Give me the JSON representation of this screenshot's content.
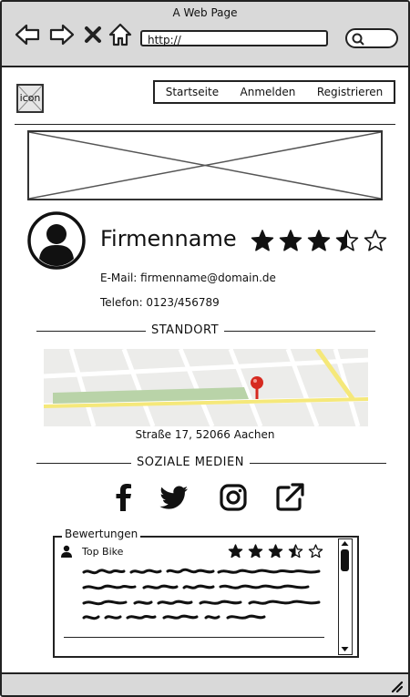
{
  "window": {
    "title": "A Web Page"
  },
  "addressbar": {
    "url": "http://"
  },
  "logo": {
    "label": "icon"
  },
  "nav": {
    "items": [
      "Startseite",
      "Anmelden",
      "Registrieren"
    ]
  },
  "company": {
    "name": "Firmenname",
    "rating": 3.5,
    "rating_max": 5,
    "email": "E-Mail: firmenname@domain.de",
    "phone": "Telefon: 0123/456789"
  },
  "location": {
    "heading": "STANDORT",
    "address": "Straße 17, 52066 Aachen"
  },
  "social": {
    "heading": "SOZIALE MEDIEN",
    "icons": [
      "facebook-icon",
      "twitter-icon",
      "instagram-icon",
      "external-link-icon"
    ]
  },
  "reviews": {
    "legend": "Bewertungen",
    "items": [
      {
        "author": "Top Bike",
        "rating": 3.5,
        "rating_max": 5
      }
    ]
  },
  "colors": {
    "chrome": "#d9d9d9",
    "map_bg": "#ececea",
    "road_yellow": "#f5e87a",
    "park_green": "#b9d3a8",
    "pin_red": "#d62a20"
  }
}
